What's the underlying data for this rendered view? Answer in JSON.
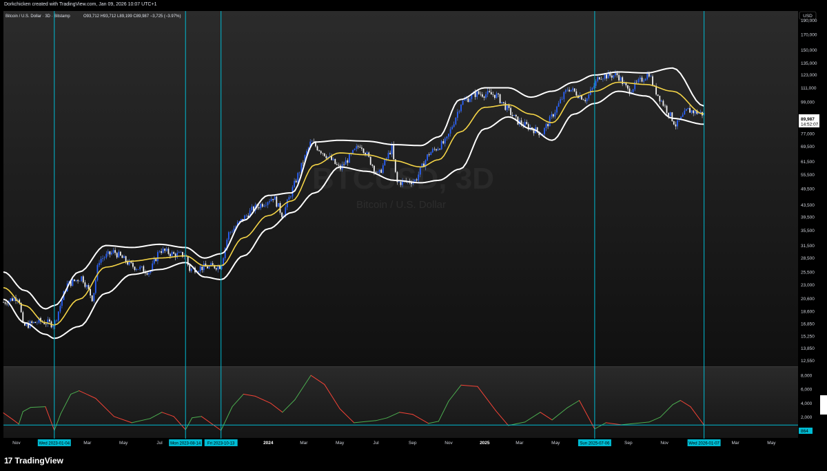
{
  "header": {
    "credit": "Dorkchicken created with TradingView.com, Jan 09, 2026 10:07 UTC+1"
  },
  "legend": {
    "symbol": "Bitcoin / U.S. Dollar · 3D · Bitstamp",
    "ohlc": "O93,712  H93,712  L89,199  C89,987  −3,725 (−3.97%)"
  },
  "watermark": {
    "ticker": "BTCUSD, 3D",
    "name": "Bitcoin / U.S. Dollar"
  },
  "price_axis": {
    "currency": "USD",
    "last_price": "89,987",
    "countdown": "14:52:07"
  },
  "osc_axis": {
    "last_value": "864"
  },
  "footer": {
    "brand": "TradingView"
  },
  "colors": {
    "background": "#000000",
    "vline": "#00bcd4",
    "bands": "#ffffff",
    "basis": "#f5d547",
    "candles": "#2962ff",
    "osc_up": "#4caf50",
    "osc_down": "#f44336"
  },
  "chart_data": {
    "type": "candlestick",
    "price_scale": "log",
    "price_ticks": [
      12550,
      13850,
      15250,
      16850,
      18600,
      20600,
      23000,
      25500,
      28500,
      31500,
      35500,
      39500,
      43500,
      49500,
      55500,
      61500,
      69500,
      77000,
      87000,
      99000,
      111000,
      123000,
      135000,
      150000,
      170000,
      190000
    ],
    "price_tick_labels": [
      "12,550",
      "13,850",
      "15,250",
      "16,850",
      "18,600",
      "20,600",
      "23,000",
      "25,500",
      "28,500",
      "31,500",
      "35,500",
      "39,500",
      "43,500",
      "49,500",
      "55,500",
      "61,500",
      "69,500",
      "77,000",
      "87,000",
      "99,000",
      "111,000",
      "123,000",
      "135,000",
      "150,000",
      "170,000",
      "190,000"
    ],
    "price_range": [
      12000,
      205000
    ],
    "time_range": [
      "2022-10-10",
      "2026-06-15"
    ],
    "time_ticks": [
      {
        "label": "Nov",
        "date": "2022-11-01",
        "bold": false
      },
      {
        "label": "Mar",
        "date": "2023-03-01",
        "bold": false
      },
      {
        "label": "May",
        "date": "2023-05-01",
        "bold": false
      },
      {
        "label": "Jul",
        "date": "2023-07-01",
        "bold": false
      },
      {
        "label": "2024",
        "date": "2024-01-01",
        "bold": true
      },
      {
        "label": "Mar",
        "date": "2024-03-01",
        "bold": false
      },
      {
        "label": "May",
        "date": "2024-05-01",
        "bold": false
      },
      {
        "label": "Jul",
        "date": "2024-07-01",
        "bold": false
      },
      {
        "label": "Sep",
        "date": "2024-09-01",
        "bold": false
      },
      {
        "label": "Nov",
        "date": "2024-11-01",
        "bold": false
      },
      {
        "label": "2025",
        "date": "2025-01-01",
        "bold": true
      },
      {
        "label": "Mar",
        "date": "2025-03-01",
        "bold": false
      },
      {
        "label": "May",
        "date": "2025-05-01",
        "bold": false
      },
      {
        "label": "Sep",
        "date": "2025-09-01",
        "bold": false
      },
      {
        "label": "Nov",
        "date": "2025-11-01",
        "bold": false
      },
      {
        "label": "Mar",
        "date": "2026-03-01",
        "bold": false
      },
      {
        "label": "May",
        "date": "2026-05-01",
        "bold": false
      }
    ],
    "vertical_markers": [
      {
        "label": "Wed 2023-01-04",
        "date": "2023-01-04"
      },
      {
        "label": "Mon 2023-08-14",
        "date": "2023-08-14"
      },
      {
        "label": "Fri 2023-10-13",
        "date": "2023-10-13"
      },
      {
        "label": "Sun 2025-07-06",
        "date": "2025-07-06"
      },
      {
        "label": "Wed 2026-01-07",
        "date": "2026-01-07"
      }
    ],
    "bollinger": {
      "basis": [
        [
          "2022-10-10",
          22500
        ],
        [
          "2022-11-15",
          19500
        ],
        [
          "2022-12-20",
          17000
        ],
        [
          "2023-01-04",
          16700
        ],
        [
          "2023-02-15",
          20500
        ],
        [
          "2023-04-01",
          26500
        ],
        [
          "2023-05-15",
          27800
        ],
        [
          "2023-07-01",
          28500
        ],
        [
          "2023-08-14",
          29000
        ],
        [
          "2023-09-15",
          26800
        ],
        [
          "2023-10-13",
          26800
        ],
        [
          "2023-11-20",
          33500
        ],
        [
          "2024-01-01",
          40000
        ],
        [
          "2024-02-10",
          45000
        ],
        [
          "2024-03-20",
          60000
        ],
        [
          "2024-05-01",
          66000
        ],
        [
          "2024-06-15",
          65000
        ],
        [
          "2024-08-01",
          62000
        ],
        [
          "2024-09-15",
          59000
        ],
        [
          "2024-10-15",
          62500
        ],
        [
          "2024-11-20",
          78000
        ],
        [
          "2025-01-01",
          95000
        ],
        [
          "2025-02-10",
          97000
        ],
        [
          "2025-03-20",
          90000
        ],
        [
          "2025-04-25",
          84000
        ],
        [
          "2025-06-01",
          103000
        ],
        [
          "2025-07-06",
          108000
        ],
        [
          "2025-08-15",
          116000
        ],
        [
          "2025-10-01",
          114000
        ],
        [
          "2025-11-15",
          108000
        ],
        [
          "2026-01-07",
          90000
        ]
      ],
      "upper": [
        [
          "2022-10-10",
          25500
        ],
        [
          "2022-11-15",
          22000
        ],
        [
          "2022-12-20",
          19000
        ],
        [
          "2023-01-04",
          19500
        ],
        [
          "2023-02-15",
          25500
        ],
        [
          "2023-04-01",
          31500
        ],
        [
          "2023-05-15",
          31000
        ],
        [
          "2023-07-01",
          31800
        ],
        [
          "2023-08-14",
          31000
        ],
        [
          "2023-09-15",
          28500
        ],
        [
          "2023-10-13",
          29500
        ],
        [
          "2023-11-20",
          38500
        ],
        [
          "2024-01-01",
          47000
        ],
        [
          "2024-02-10",
          48000
        ],
        [
          "2024-03-20",
          72000
        ],
        [
          "2024-05-01",
          73000
        ],
        [
          "2024-06-15",
          72500
        ],
        [
          "2024-08-01",
          70500
        ],
        [
          "2024-09-15",
          70000
        ],
        [
          "2024-10-15",
          75000
        ],
        [
          "2024-11-20",
          101000
        ],
        [
          "2025-01-01",
          111000
        ],
        [
          "2025-02-10",
          111000
        ],
        [
          "2025-03-20",
          103000
        ],
        [
          "2025-04-25",
          108000
        ],
        [
          "2025-06-01",
          116000
        ],
        [
          "2025-07-06",
          123000
        ],
        [
          "2025-08-15",
          126000
        ],
        [
          "2025-10-01",
          125000
        ],
        [
          "2025-11-15",
          130000
        ],
        [
          "2026-01-07",
          96000
        ]
      ],
      "lower": [
        [
          "2022-10-10",
          20500
        ],
        [
          "2022-11-15",
          17000
        ],
        [
          "2022-12-20",
          15500
        ],
        [
          "2023-01-04",
          15000
        ],
        [
          "2023-02-15",
          16500
        ],
        [
          "2023-04-01",
          21500
        ],
        [
          "2023-05-15",
          25000
        ],
        [
          "2023-07-01",
          26000
        ],
        [
          "2023-08-14",
          27500
        ],
        [
          "2023-09-15",
          24500
        ],
        [
          "2023-10-13",
          24000
        ],
        [
          "2023-11-20",
          29000
        ],
        [
          "2024-01-01",
          36000
        ],
        [
          "2024-02-10",
          41000
        ],
        [
          "2024-03-20",
          48000
        ],
        [
          "2024-05-01",
          59000
        ],
        [
          "2024-06-15",
          57000
        ],
        [
          "2024-08-01",
          53000
        ],
        [
          "2024-09-15",
          52000
        ],
        [
          "2024-10-15",
          53000
        ],
        [
          "2024-11-20",
          58000
        ],
        [
          "2025-01-01",
          80000
        ],
        [
          "2025-02-10",
          88000
        ],
        [
          "2025-03-20",
          80000
        ],
        [
          "2025-04-25",
          73000
        ],
        [
          "2025-06-01",
          90000
        ],
        [
          "2025-07-06",
          98000
        ],
        [
          "2025-08-15",
          108000
        ],
        [
          "2025-10-01",
          104000
        ],
        [
          "2025-11-15",
          87000
        ],
        [
          "2026-01-07",
          83000
        ]
      ]
    },
    "price_path": [
      [
        "2022-10-10",
        20000
      ],
      [
        "2022-11-05",
        21000
      ],
      [
        "2022-11-12",
        16500
      ],
      [
        "2022-12-10",
        17200
      ],
      [
        "2023-01-04",
        16800
      ],
      [
        "2023-01-25",
        23000
      ],
      [
        "2023-02-20",
        24500
      ],
      [
        "2023-03-10",
        20500
      ],
      [
        "2023-03-20",
        28000
      ],
      [
        "2023-04-15",
        30000
      ],
      [
        "2023-05-15",
        26800
      ],
      [
        "2023-06-15",
        25500
      ],
      [
        "2023-07-01",
        30500
      ],
      [
        "2023-07-25",
        29300
      ],
      [
        "2023-08-14",
        29200
      ],
      [
        "2023-08-20",
        26000
      ],
      [
        "2023-09-15",
        26500
      ],
      [
        "2023-10-13",
        26800
      ],
      [
        "2023-10-25",
        34500
      ],
      [
        "2023-12-05",
        42000
      ],
      [
        "2024-01-10",
        46500
      ],
      [
        "2024-01-25",
        40000
      ],
      [
        "2024-02-15",
        52000
      ],
      [
        "2024-03-13",
        72000
      ],
      [
        "2024-04-15",
        63000
      ],
      [
        "2024-05-01",
        58000
      ],
      [
        "2024-06-05",
        71000
      ],
      [
        "2024-07-05",
        55000
      ],
      [
        "2024-07-28",
        69000
      ],
      [
        "2024-08-05",
        52000
      ],
      [
        "2024-09-06",
        53000
      ],
      [
        "2024-09-28",
        65500
      ],
      [
        "2024-10-28",
        72500
      ],
      [
        "2024-11-22",
        98500
      ],
      [
        "2024-12-17",
        106000
      ],
      [
        "2025-01-20",
        105000
      ],
      [
        "2025-02-25",
        85000
      ],
      [
        "2025-04-08",
        77000
      ],
      [
        "2025-05-22",
        111000
      ],
      [
        "2025-06-22",
        101000
      ],
      [
        "2025-07-14",
        122000
      ],
      [
        "2025-08-14",
        123000
      ],
      [
        "2025-09-01",
        108000
      ],
      [
        "2025-10-06",
        125000
      ],
      [
        "2025-10-15",
        110000
      ],
      [
        "2025-11-21",
        82000
      ],
      [
        "2025-12-10",
        93000
      ],
      [
        "2026-01-07",
        89987
      ]
    ],
    "oscillator": {
      "range": [
        0,
        9000
      ],
      "ticks": [
        2000,
        4000,
        6000,
        8000
      ],
      "tick_labels": [
        "2,000",
        "4,000",
        "6,000",
        "8,000"
      ],
      "points": [
        [
          "2022-10-10",
          2600
        ],
        [
          "2022-10-25",
          1700
        ],
        [
          "2022-11-05",
          1000
        ],
        [
          "2022-11-12",
          2800
        ],
        [
          "2022-11-25",
          3400
        ],
        [
          "2022-12-20",
          3500
        ],
        [
          "2023-01-04",
          100
        ],
        [
          "2023-01-15",
          2500
        ],
        [
          "2023-02-01",
          5300
        ],
        [
          "2023-02-15",
          5800
        ],
        [
          "2023-03-15",
          4700
        ],
        [
          "2023-04-15",
          2100
        ],
        [
          "2023-05-15",
          1200
        ],
        [
          "2023-06-15",
          1800
        ],
        [
          "2023-07-05",
          2700
        ],
        [
          "2023-07-25",
          2100
        ],
        [
          "2023-08-14",
          200
        ],
        [
          "2023-08-25",
          1900
        ],
        [
          "2023-09-10",
          2100
        ],
        [
          "2023-10-13",
          100
        ],
        [
          "2023-11-01",
          3500
        ],
        [
          "2023-11-20",
          5300
        ],
        [
          "2023-12-10",
          5000
        ],
        [
          "2024-01-05",
          4000
        ],
        [
          "2024-01-25",
          2700
        ],
        [
          "2024-02-15",
          4500
        ],
        [
          "2024-03-13",
          8000
        ],
        [
          "2024-04-05",
          6700
        ],
        [
          "2024-05-01",
          3200
        ],
        [
          "2024-05-25",
          1200
        ],
        [
          "2024-07-01",
          1500
        ],
        [
          "2024-07-20",
          1900
        ],
        [
          "2024-08-10",
          2700
        ],
        [
          "2024-09-01",
          2400
        ],
        [
          "2024-09-28",
          1100
        ],
        [
          "2024-10-15",
          1400
        ],
        [
          "2024-11-01",
          4300
        ],
        [
          "2024-11-22",
          6600
        ],
        [
          "2024-12-20",
          6400
        ],
        [
          "2025-01-20",
          2900
        ],
        [
          "2025-02-10",
          800
        ],
        [
          "2025-03-10",
          1300
        ],
        [
          "2025-04-05",
          2700
        ],
        [
          "2025-04-25",
          1600
        ],
        [
          "2025-05-20",
          3300
        ],
        [
          "2025-06-10",
          4400
        ],
        [
          "2025-07-06",
          300
        ],
        [
          "2025-07-25",
          1200
        ],
        [
          "2025-08-20",
          900
        ],
        [
          "2025-10-06",
          1300
        ],
        [
          "2025-10-25",
          2000
        ],
        [
          "2025-11-15",
          3800
        ],
        [
          "2025-11-28",
          4400
        ],
        [
          "2025-12-15",
          3500
        ],
        [
          "2026-01-07",
          860
        ]
      ],
      "last_value": 864
    }
  }
}
